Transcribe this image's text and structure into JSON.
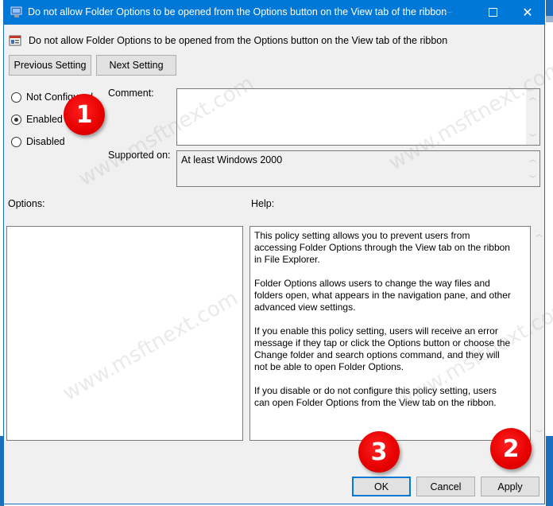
{
  "window": {
    "title": "Do not allow Folder Options to be opened from the Options button on the View tab of the ribbon",
    "controls": {
      "minimize": "—",
      "maximize": "☐",
      "close": "✕"
    }
  },
  "policy": {
    "title": "Do not allow Folder Options to be opened from the Options button on the View tab of the ribbon"
  },
  "nav": {
    "previous_label": "Previous Setting",
    "next_label": "Next Setting"
  },
  "state": {
    "options": [
      {
        "label": "Not Configured",
        "selected": false
      },
      {
        "label": "Enabled",
        "selected": true
      },
      {
        "label": "Disabled",
        "selected": false
      }
    ]
  },
  "comment": {
    "label": "Comment:",
    "value": ""
  },
  "supported": {
    "label": "Supported on:",
    "value": "At least Windows 2000"
  },
  "options_panel": {
    "label": "Options:"
  },
  "help": {
    "label": "Help:",
    "paragraphs": [
      "This policy setting allows you to prevent users from accessing Folder Options through the View tab on the ribbon in File Explorer.",
      "Folder Options allows users to change the way files and folders open, what appears in the navigation pane, and other advanced view settings.",
      "If you enable this policy setting, users will receive an error message if they tap or click the Options button or choose the Change folder and search options command, and they will not be able to open Folder Options.",
      "If you disable or do not configure this policy setting, users can open Folder Options from the View tab on the ribbon."
    ]
  },
  "footer": {
    "ok_label": "OK",
    "cancel_label": "Cancel",
    "apply_label": "Apply"
  },
  "annotations": {
    "badge1": "1",
    "badge2": "2",
    "badge3": "3",
    "color": "#e60000"
  },
  "watermark": "www.msftnext.com",
  "colors": {
    "titlebar": "#0078d7",
    "dialog_bg": "#f0f0f0"
  }
}
